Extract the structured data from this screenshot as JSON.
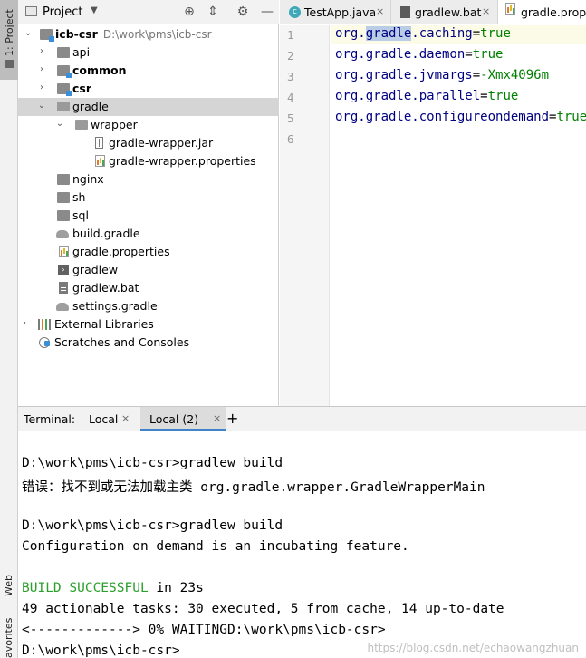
{
  "side_strip": {
    "project_tab": "1: Project",
    "web_tab": "Web",
    "favorites_tab": "avorites"
  },
  "project_panel": {
    "title": "Project",
    "dropdown_arrow": "▼",
    "header_icons": [
      "target-icon",
      "collapse-icon",
      "gear-icon",
      "hide-icon"
    ],
    "root": {
      "label": "icb-csr",
      "path": "D:\\work\\pms\\icb-csr"
    },
    "items": [
      {
        "label": "api",
        "bold": false
      },
      {
        "label": "common",
        "bold": true
      },
      {
        "label": "csr",
        "bold": true
      },
      {
        "label": "gradle",
        "bold": false
      },
      {
        "label": "wrapper",
        "bold": false
      },
      {
        "label": "gradle-wrapper.jar",
        "bold": false
      },
      {
        "label": "gradle-wrapper.properties",
        "bold": false
      },
      {
        "label": "nginx",
        "bold": false
      },
      {
        "label": "sh",
        "bold": false
      },
      {
        "label": "sql",
        "bold": false
      },
      {
        "label": "build.gradle",
        "bold": false
      },
      {
        "label": "gradle.properties",
        "bold": false
      },
      {
        "label": "gradlew",
        "bold": false
      },
      {
        "label": "gradlew.bat",
        "bold": false
      },
      {
        "label": "settings.gradle",
        "bold": false
      },
      {
        "label": "External Libraries",
        "bold": false
      },
      {
        "label": "Scratches and Consoles",
        "bold": false
      }
    ]
  },
  "editor": {
    "tabs": [
      {
        "label": "TestApp.java",
        "close": "×"
      },
      {
        "label": "gradlew.bat",
        "close": "×"
      },
      {
        "label": "gradle.properties",
        "close": "×"
      }
    ],
    "line_numbers": [
      "1",
      "2",
      "3",
      "4",
      "5",
      "6"
    ],
    "lines": [
      {
        "prefix": "org.",
        "highlight": "gradle",
        "key": ".caching",
        "eq": "=",
        "value": "true"
      },
      {
        "prefix": "org.gradle.daemon",
        "highlight": "",
        "key": "",
        "eq": "=",
        "value": "true"
      },
      {
        "prefix": "org.gradle.jvmargs",
        "highlight": "",
        "key": "",
        "eq": "=",
        "value": "-Xmx4096m"
      },
      {
        "prefix": "org.gradle.parallel",
        "highlight": "",
        "key": "",
        "eq": "=",
        "value": "true"
      },
      {
        "prefix": "org.gradle.configureondemand",
        "highlight": "",
        "key": "",
        "eq": "=",
        "value": "true"
      },
      {
        "prefix": "",
        "highlight": "",
        "key": "",
        "eq": "",
        "value": ""
      }
    ]
  },
  "terminal": {
    "label": "Terminal:",
    "tabs": [
      {
        "label": "Local",
        "close": "×"
      },
      {
        "label": "Local (2)",
        "close": "×"
      }
    ],
    "add": "+",
    "lines": [
      "D:\\work\\pms\\icb-csr>gradlew build",
      "错误：找不到或无法加载主类 org.gradle.wrapper.GradleWrapperMain",
      "",
      "D:\\work\\pms\\icb-csr>gradlew build",
      "Configuration on demand is an incubating feature.",
      "",
      "BUILD SUCCESSFUL",
      "49 actionable tasks: 30 executed, 5 from cache, 14 up-to-date",
      "<-------------> 0% WAITINGD:\\work\\pms\\icb-csr>",
      "D:\\work\\pms\\icb-csr>"
    ],
    "build_time": " in 23s",
    "watermark": "https://blog.csdn.net/echaowangzhuan"
  },
  "colors": {
    "selection": "#d5d5d5",
    "keyword": "#000080",
    "value": "#008000",
    "success": "#2ca02c",
    "accent": "#4083c9"
  }
}
